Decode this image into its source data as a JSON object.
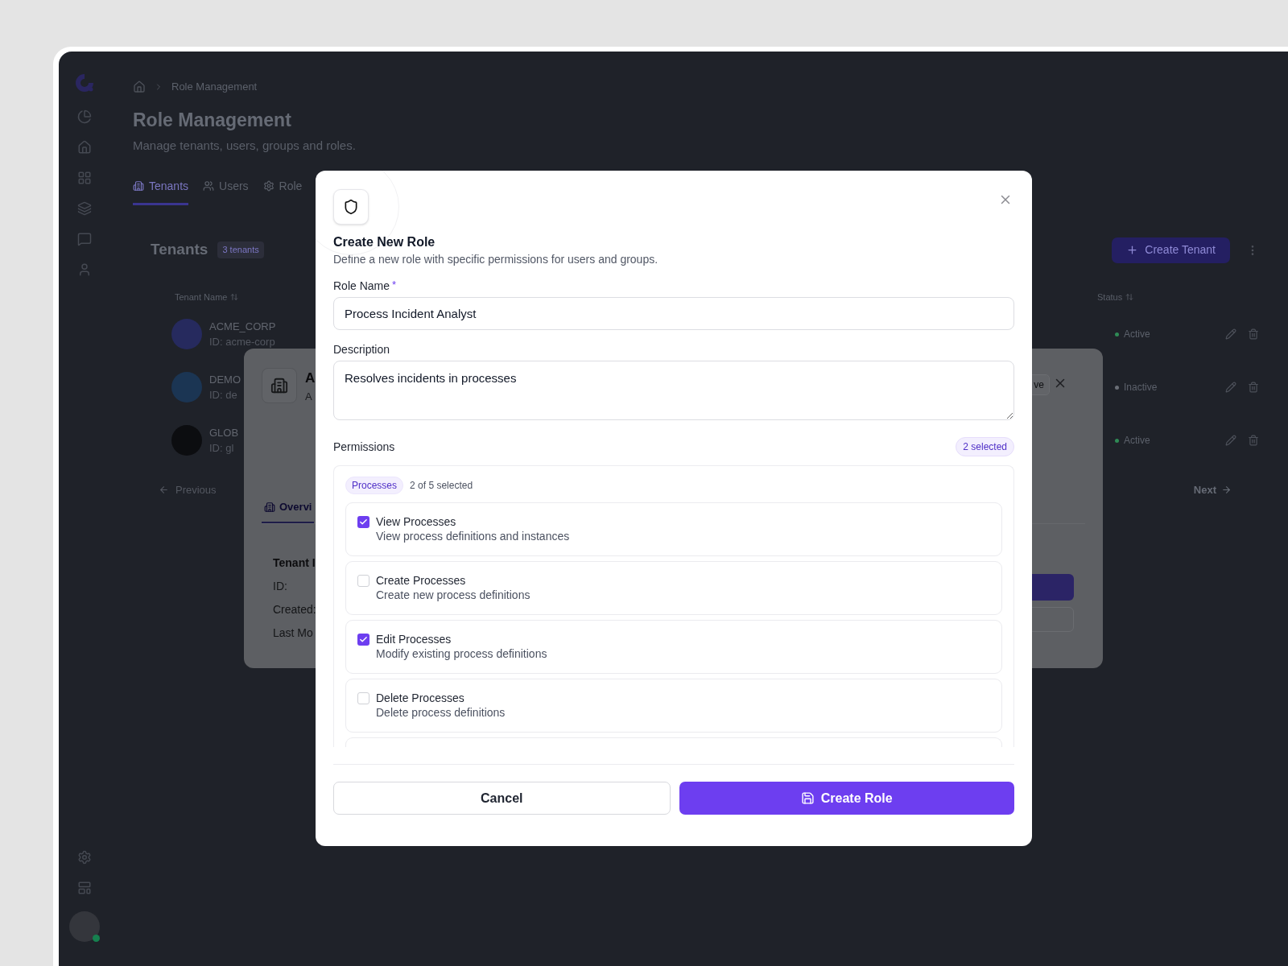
{
  "breadcrumb": {
    "current": "Role Management"
  },
  "page": {
    "title": "Role Management",
    "subtitle": "Manage tenants, users, groups and roles."
  },
  "tabs": [
    {
      "label": "Tenants",
      "selected": true
    },
    {
      "label": "Users",
      "selected": false
    },
    {
      "label": "Role",
      "selected": false
    }
  ],
  "tenants_card": {
    "title": "Tenants",
    "count": "3 tenants",
    "create_button": "Create Tenant",
    "columns": [
      "Tenant Name",
      "Status"
    ],
    "rows": [
      {
        "name": "ACME_CORP",
        "id": "ID: acme-corp",
        "status": "Active",
        "active": true,
        "color": "#262a5e"
      },
      {
        "name": "DEMO",
        "id": "ID: de",
        "status": "Inactive",
        "active": false,
        "color": "#1b3553"
      },
      {
        "name": "GLOB",
        "id": "ID: gl",
        "status": "Active",
        "active": true,
        "color": "#0c0d10"
      }
    ],
    "previous": "Previous",
    "next": "Next"
  },
  "tenant_dialog": {
    "title": "A",
    "subtitle": "A",
    "badge": "ve",
    "tab": "Overvi",
    "fields": [
      "Tenant I",
      "ID:",
      "Created:",
      "Last Mo"
    ]
  },
  "modal": {
    "title": "Create New Role",
    "subtitle": "Define a new role with specific permissions for users and groups.",
    "role_name": {
      "label": "Role Name",
      "required_mark": "*",
      "value": "Process Incident Analyst"
    },
    "description": {
      "label": "Description",
      "value": "Resolves incidents in processes"
    },
    "permissions": {
      "label": "Permissions",
      "badge": "2 selected",
      "group": "Processes",
      "group_count": "2 of 5 selected",
      "items": [
        {
          "name": "View Processes",
          "description": "View process definitions and instances",
          "checked": true
        },
        {
          "name": "Create Processes",
          "description": "Create new process definitions",
          "checked": false
        },
        {
          "name": "Edit Processes",
          "description": "Modify existing process definitions",
          "checked": true
        },
        {
          "name": "Delete Processes",
          "description": "Delete process definitions",
          "checked": false
        }
      ]
    },
    "cancel": "Cancel",
    "submit": "Create Role"
  }
}
